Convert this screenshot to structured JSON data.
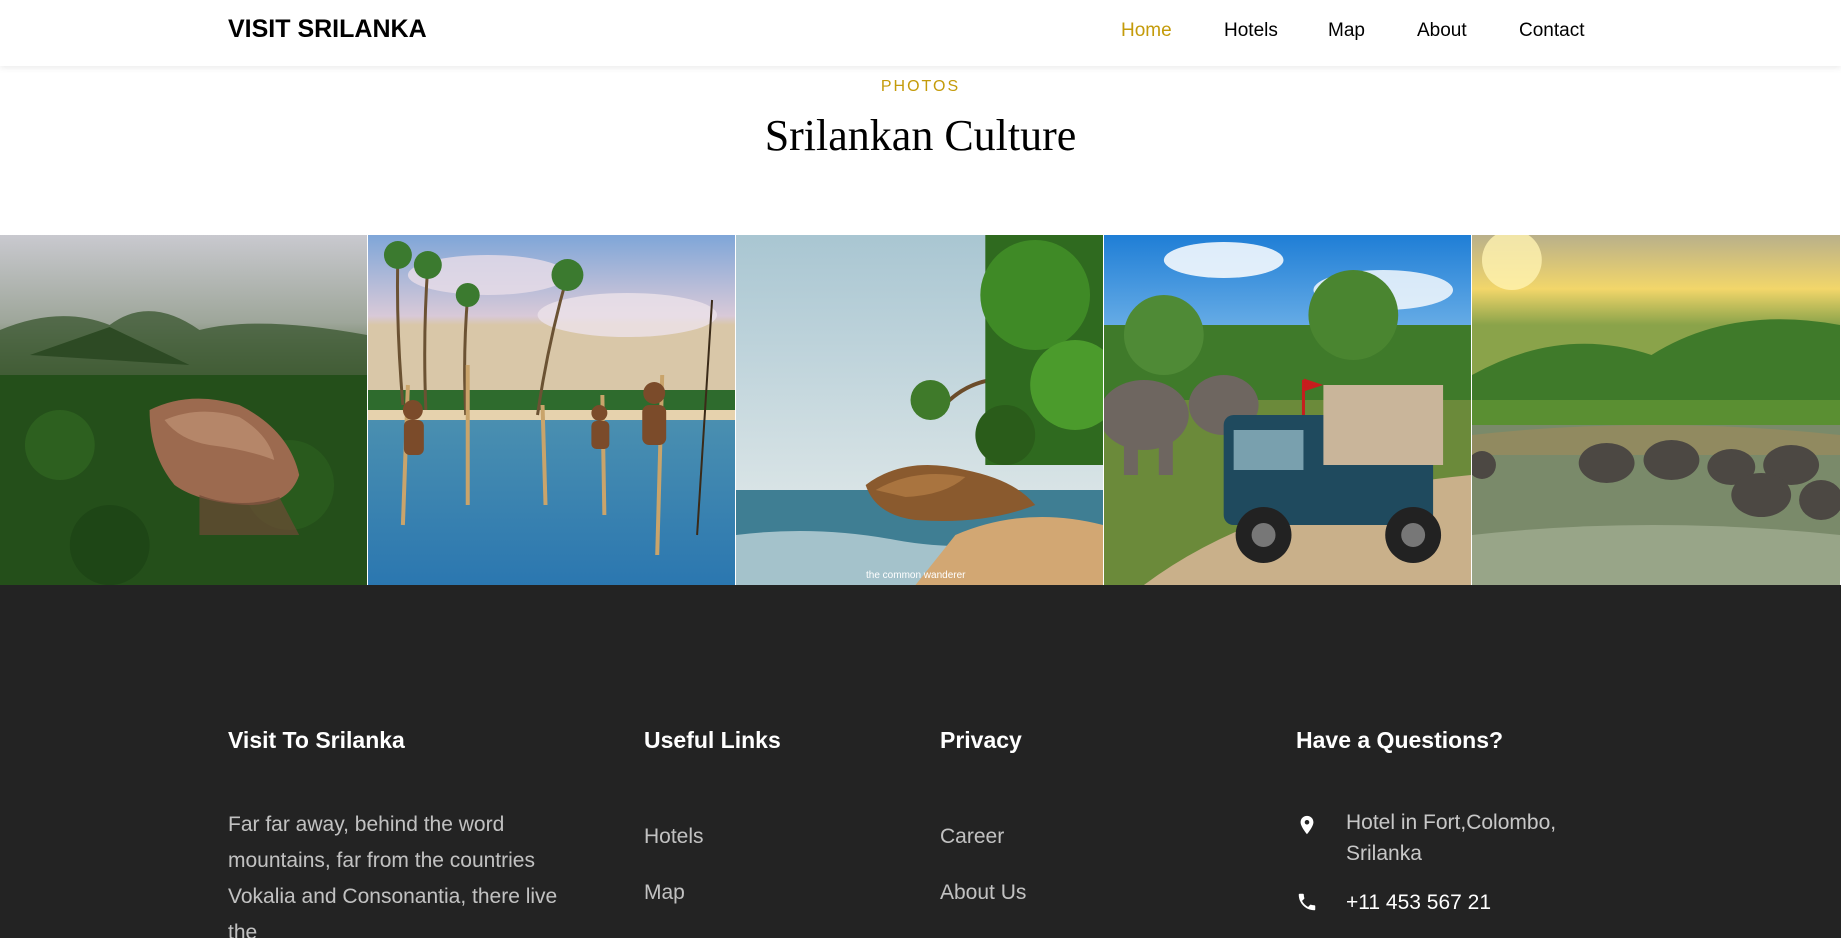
{
  "navbar": {
    "brand": "VISIT SRILANKA",
    "links": [
      "Home",
      "Hotels",
      "Map",
      "About",
      "Contact"
    ],
    "active": "Home",
    "accent_color": "#c49b0a"
  },
  "section": {
    "subheading": "PHOTOS",
    "title": "Srilankan Culture"
  },
  "gallery": {
    "photos": [
      {
        "subject": "sigiriya-rock-fortress"
      },
      {
        "subject": "stilt-fishermen"
      },
      {
        "subject": "palm-beach-rock"
      },
      {
        "subject": "elephants-safari-jeep"
      },
      {
        "subject": "elephants-river"
      }
    ],
    "watermark": "the common wanderer"
  },
  "footer": {
    "background": "#232323",
    "about": {
      "title": "Visit To Srilanka",
      "text": "Far far away, behind the word mountains, far from the countries Vokalia and Consonantia, there live the"
    },
    "useful_links": {
      "title": "Useful Links",
      "items": [
        "Hotels",
        "Map"
      ]
    },
    "privacy": {
      "title": "Privacy",
      "items": [
        "Career",
        "About Us"
      ]
    },
    "contact": {
      "title": "Have a Questions?",
      "address": "Hotel in Fort,Colombo, Srilanka",
      "phone": "+11 453 567 21",
      "icons": [
        "map-pin-icon",
        "phone-icon"
      ]
    }
  }
}
